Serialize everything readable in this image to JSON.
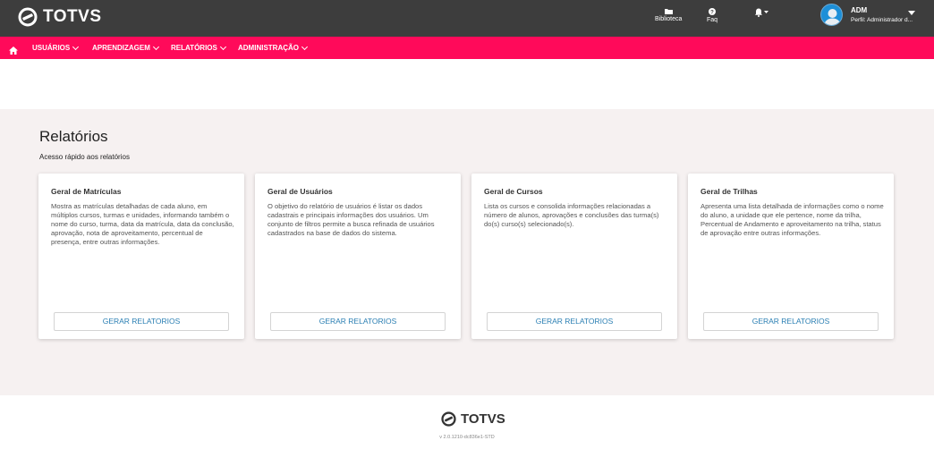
{
  "header": {
    "logo_text": "TOTVS",
    "actions": [
      {
        "label": "Biblioteca",
        "icon": "folder-icon"
      },
      {
        "label": "Faq",
        "icon": "question-icon"
      }
    ],
    "notifications_icon": "bell-icon",
    "user": {
      "name": "ADM",
      "profile": "Perfil: Administrador d..."
    }
  },
  "nav": {
    "home_icon": "home-icon",
    "items": [
      {
        "label": "USUÁRIOS"
      },
      {
        "label": "APRENDIZAGEM"
      },
      {
        "label": "RELATÓRIOS"
      },
      {
        "label": "ADMINISTRAÇÃO"
      }
    ]
  },
  "main": {
    "title": "Relatórios",
    "subtitle": "Acesso rápido aos relatórios",
    "cards": [
      {
        "title": "Geral de Matrículas",
        "description": "Mostra as matrículas detalhadas de cada aluno, em múltiplos cursos, turmas e unidades, informando também o nome do curso, turma, data da matrícula, data da conclusão, aprovação, nota de aproveitamento, percentual de presença, entre outras informações.",
        "button_label": "GERAR RELATORIOS"
      },
      {
        "title": "Geral de Usuários",
        "description": "O objetivo do relatório de usuários é listar os dados cadastrais e principais informações dos usuários. Um conjunto de filtros permite a busca refinada de usuários cadastrados na base de dados do sistema.",
        "button_label": "GERAR RELATORIOS"
      },
      {
        "title": "Geral de Cursos",
        "description": "Lista os cursos e consolida informações relacionadas a número de alunos, aprovações e conclusões das turma(s) do(s) curso(s) selecionado(s).",
        "button_label": "GERAR RELATORIOS"
      },
      {
        "title": "Geral de Trilhas",
        "description": "Apresenta uma lista detalhada de informações como o nome do aluno, a unidade que ele pertence, nome da trilha, Percentual de Andamento e aproveitamento na trilha, status de aprovação entre outras informações.",
        "button_label": "GERAR RELATORIOS"
      }
    ]
  },
  "footer": {
    "logo_text": "TOTVS",
    "version": "v 2.0.1210-dc836e1-STD"
  },
  "colors": {
    "topbar": "#3d3d3d",
    "navbar": "#ff0a5a",
    "content_bg": "#f6f1f1",
    "button_text": "#2b7fb3"
  }
}
